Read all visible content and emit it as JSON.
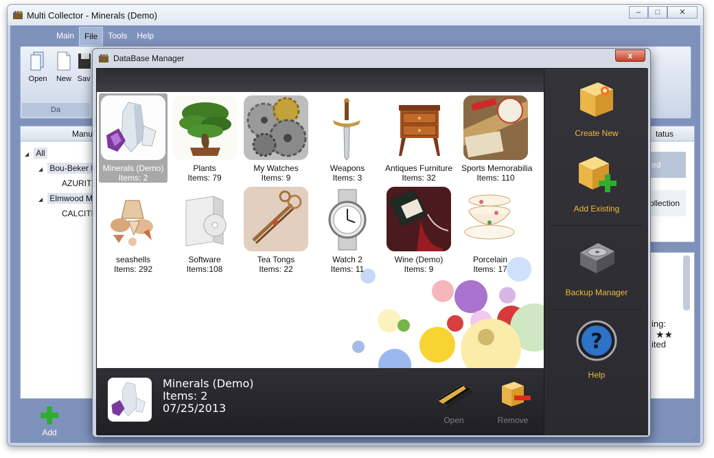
{
  "main_window": {
    "title": "Multi Collector - Minerals (Demo)",
    "controls": {
      "minimize": "–",
      "maximize": "□",
      "close": "✕"
    },
    "menu": [
      "Main",
      "File",
      "Tools",
      "Help"
    ],
    "active_menu": "File",
    "ribbon": {
      "buttons": [
        "Open",
        "New",
        "Sav"
      ],
      "group_label": "Da"
    },
    "left_panel": {
      "header": "Manuf",
      "tree": {
        "root": "All",
        "node1": "Bou-Beker M",
        "leaf1": "AZURITE",
        "node2": "Elmwood M",
        "leaf2": "CALCITE"
      }
    },
    "right_panel": {
      "header": "tatus",
      "row1": "ted",
      "row2": "ollection"
    },
    "right_panel2": {
      "line1": "ing:",
      "stars": "★★",
      "line3": "ited"
    },
    "add_label": "Add",
    "grip": "⋰"
  },
  "dialog": {
    "title": "DataBase Manager",
    "close": "x",
    "databases": [
      {
        "name": "Minerals (Demo)",
        "items": "Items: 2",
        "selected": true
      },
      {
        "name": "Plants",
        "items": "Items: 79"
      },
      {
        "name": "My Watches",
        "items": "Items: 9"
      },
      {
        "name": "Weapons",
        "items": "Items: 3"
      },
      {
        "name": "Antiques Furniture",
        "items": "Items: 32"
      },
      {
        "name": "Sports Memorabilia",
        "items": "Items: 110"
      },
      {
        "name": "seashells",
        "items": "Items: 292"
      },
      {
        "name": "Software",
        "items": "Items:108"
      },
      {
        "name": "Tea Tongs",
        "items": "Items: 22"
      },
      {
        "name": "Watch 2",
        "items": "Items: 11"
      },
      {
        "name": "Wine (Demo)",
        "items": "Items: 9"
      },
      {
        "name": "Porcelain",
        "items": "Items: 17"
      }
    ],
    "info": {
      "name": "Minerals (Demo)",
      "items": "Items: 2",
      "date": "07/25/2013"
    },
    "actions": {
      "open": "Open",
      "remove": "Remove"
    },
    "side": {
      "create_new": "Create New",
      "add_existing": "Add Existing",
      "backup_manager": "Backup Manager",
      "help": "Help"
    }
  }
}
